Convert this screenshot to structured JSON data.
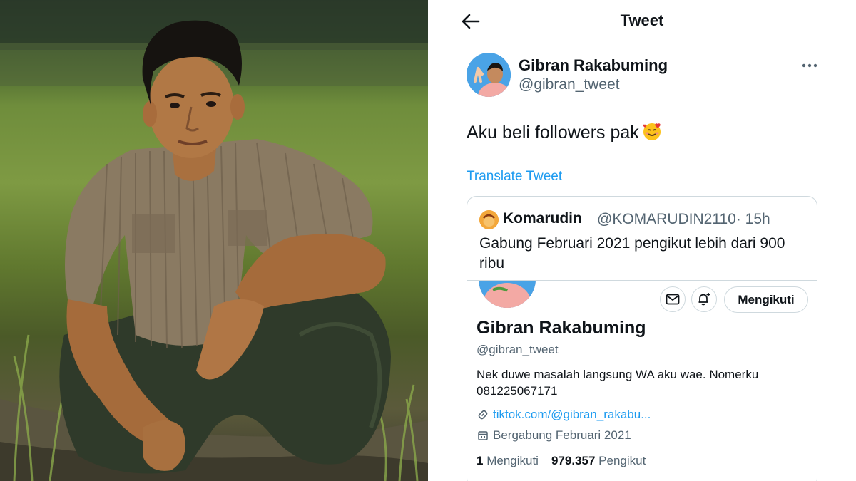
{
  "header": {
    "title": "Tweet"
  },
  "tweet": {
    "author_name": "Gibran Rakabuming",
    "author_handle": "@gibran_tweet",
    "text": "Aku beli followers pak",
    "emoji": "smiling-face-with-hearts",
    "translate_label": "Translate Tweet"
  },
  "quote": {
    "author_name": "Komarudin",
    "author_handle": "@KOMARUDIN2110",
    "time": "· 15h",
    "text": "Gabung Februari 2021 pengikut lebih dari 900 ribu",
    "profile": {
      "name": "Gibran Rakabuming",
      "handle": "@gibran_tweet",
      "bio": "Nek duwe masalah langsung WA aku wae. Nomerku 081225067171",
      "link": "tiktok.com/@gibran_rakabu...",
      "joined": "Bergabung Februari 2021",
      "following_count": "1",
      "following_label": "Mengikuti",
      "followers_count": "979.357",
      "followers_label": "Pengikut",
      "follow_button_label": "Mengikuti"
    }
  },
  "colors": {
    "accent": "#1d9bf0",
    "text": "#0f1419",
    "secondary": "#536471",
    "border": "#cfd9de"
  }
}
